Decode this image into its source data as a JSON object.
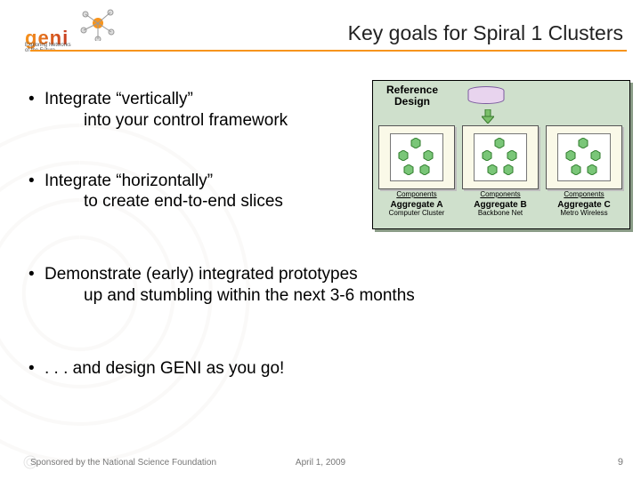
{
  "logo": {
    "word": "geni",
    "tag1": "Exploring Networks",
    "tag2": "of the Future"
  },
  "title": "Key goals for Spiral 1 Clusters",
  "bullets": [
    {
      "main": "Integrate “vertically”",
      "sub": "into your control framework"
    },
    {
      "main": "Integrate “horizontally”",
      "sub": "to create end-to-end slices"
    },
    {
      "main": "Demonstrate (early) integrated prototypes",
      "sub": "up and stumbling within the next 3-6 months"
    },
    {
      "main": ". . . and design GENI as you go!",
      "sub": ""
    }
  ],
  "diagram": {
    "ref_label": "Reference Design",
    "components_word": "Components",
    "aggregates": [
      {
        "name": "Aggregate A",
        "sub": "Computer Cluster"
      },
      {
        "name": "Aggregate B",
        "sub": "Backbone Net"
      },
      {
        "name": "Aggregate C",
        "sub": "Metro Wireless"
      }
    ]
  },
  "footer": {
    "sponsor": "Sponsored by the National Science Foundation",
    "date": "April 1, 2009",
    "page": "9"
  },
  "colors": {
    "accent": "#f7941d",
    "diagram_bg": "#cfe0cc",
    "hex": "#7ac678"
  }
}
